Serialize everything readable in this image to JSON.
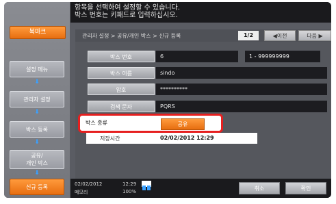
{
  "header": {
    "message_line1": "항목을 선택하여 설정할 수 있습니다.",
    "message_line2": "박스 번호는 키패드로 입력하십시오."
  },
  "sidebar": {
    "bookmark_label": "북마크",
    "items": [
      {
        "label": "설정 메뉴"
      },
      {
        "label": "관리자 설정"
      },
      {
        "label": "박스 등록"
      },
      {
        "label": "공유/\n개인 박스"
      },
      {
        "label": "신규 등록"
      }
    ],
    "arrow_glyph": "⬇"
  },
  "breadcrumb": {
    "text": "관리자 설정 > 공유/개인 박스 > 신규 등록",
    "page_indicator": "1/2",
    "prev_label": "◀이전",
    "next_label": "다음 ▶"
  },
  "form": {
    "rows": [
      {
        "label": "박스 번호",
        "value": "6",
        "range": "1 - 999999999"
      },
      {
        "label": "박스 이름",
        "value": "sindo"
      },
      {
        "label": "암호",
        "value": "**********"
      },
      {
        "label": "검색 문자",
        "value": "PQRS"
      }
    ],
    "box_type": {
      "label": "박스 종류",
      "value": "공유"
    },
    "save_time": {
      "label": "저장시간",
      "value": "02/02/2012   12:29"
    }
  },
  "status": {
    "date": "02/02/2012",
    "time": "12:29",
    "memory_label": "메모리",
    "memory_value": "100%"
  },
  "footer": {
    "cancel_label": "취소",
    "ok_label": "확인"
  },
  "colors": {
    "accent": "#e76e10",
    "highlight": "#e61f1f"
  }
}
